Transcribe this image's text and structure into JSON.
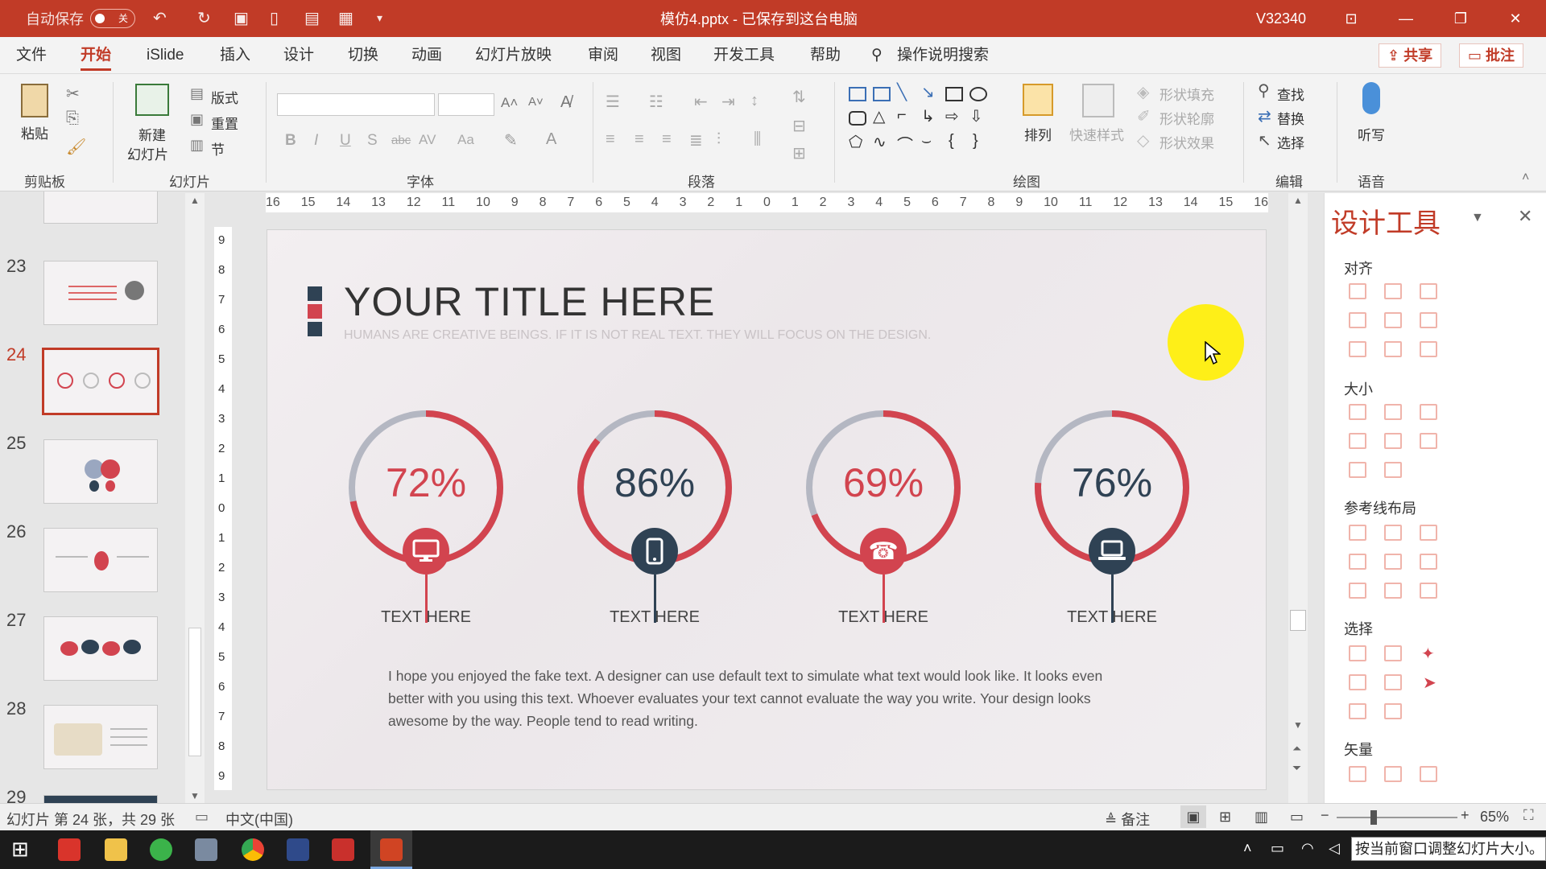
{
  "titlebar": {
    "autosave_label": "自动保存",
    "autosave_state": "关",
    "doc_title": "模仿4.pptx - 已保存到这台电脑",
    "user": "V32340"
  },
  "menu": {
    "tabs": [
      "文件",
      "开始",
      "iSlide",
      "插入",
      "设计",
      "切换",
      "动画",
      "幻灯片放映",
      "审阅",
      "视图",
      "开发工具",
      "帮助"
    ],
    "search": "操作说明搜索",
    "share": "共享",
    "comment": "批注"
  },
  "ribbon": {
    "clipboard": {
      "paste": "粘贴",
      "label": "剪贴板"
    },
    "slides": {
      "new_slide_1": "新建",
      "new_slide_2": "幻灯片",
      "layout": "版式",
      "reset": "重置",
      "section": "节",
      "label": "幻灯片"
    },
    "font": {
      "bold": "B",
      "italic": "I",
      "underline": "U",
      "shadow": "S",
      "strike": "abc",
      "spacing": "AV",
      "case": "Aa",
      "label": "字体"
    },
    "paragraph": {
      "label": "段落"
    },
    "drawing": {
      "arrange": "排列",
      "quick_style": "快速样式",
      "fill": "形状填充",
      "outline": "形状轮廓",
      "effect": "形状效果",
      "label": "绘图"
    },
    "editing": {
      "find": "查找",
      "replace": "替换",
      "select": "选择",
      "label": "编辑"
    },
    "voice": {
      "dictate": "听写",
      "label": "语音"
    }
  },
  "ruler_h": "16 15 14 13 12 11 10 9 8 7 6 5 4 3 2 1 0 1 2 3 4 5 6 7 8 9 10 11 12 13 14 15 16",
  "ruler_v": [
    "9",
    "8",
    "7",
    "6",
    "5",
    "4",
    "3",
    "2",
    "1",
    "0",
    "1",
    "2",
    "3",
    "4",
    "5",
    "6",
    "7",
    "8",
    "9"
  ],
  "thumbnails": [
    {
      "num": "23"
    },
    {
      "num": "24"
    },
    {
      "num": "25"
    },
    {
      "num": "26"
    },
    {
      "num": "27"
    },
    {
      "num": "28"
    },
    {
      "num": "29"
    }
  ],
  "slide": {
    "title": "YOUR TITLE HERE",
    "subtitle": "HUMANS ARE CREATIVE BEINGS. IF IT IS NOT REAL TEXT. THEY WILL FOCUS ON THE DESIGN.",
    "items": [
      {
        "percent": "72%",
        "value": 72,
        "label": "TEXT HERE",
        "icon": "monitor-icon",
        "theme": "red"
      },
      {
        "percent": "86%",
        "value": 86,
        "label": "TEXT HERE",
        "icon": "phone-icon",
        "theme": "navy"
      },
      {
        "percent": "69%",
        "value": 69,
        "label": "TEXT HERE",
        "icon": "telephone-icon",
        "theme": "red"
      },
      {
        "percent": "76%",
        "value": 76,
        "label": "TEXT HERE",
        "icon": "laptop-icon",
        "theme": "navy"
      }
    ],
    "paragraph": "I hope you enjoyed the fake text. A designer can use default text to simulate what text would look like. It looks even better with you using this text. Whoever evaluates your text cannot evaluate the way you write. Your design looks awesome by the way. People tend to read writing.",
    "colors": {
      "red": "#d2444f",
      "navy": "#2f4254",
      "gray": "#b4b7c2"
    }
  },
  "design_pane": {
    "title": "设计工具",
    "sections": [
      "对齐",
      "大小",
      "参考线布局",
      "选择",
      "矢量"
    ]
  },
  "status": {
    "slide_info": "幻灯片 第 24 张，共 29 张",
    "language": "中文(中国)",
    "notes": "备注",
    "zoom": "65%"
  },
  "taskbar": {
    "tooltip": "按当前窗口调整幻灯片大小。"
  }
}
